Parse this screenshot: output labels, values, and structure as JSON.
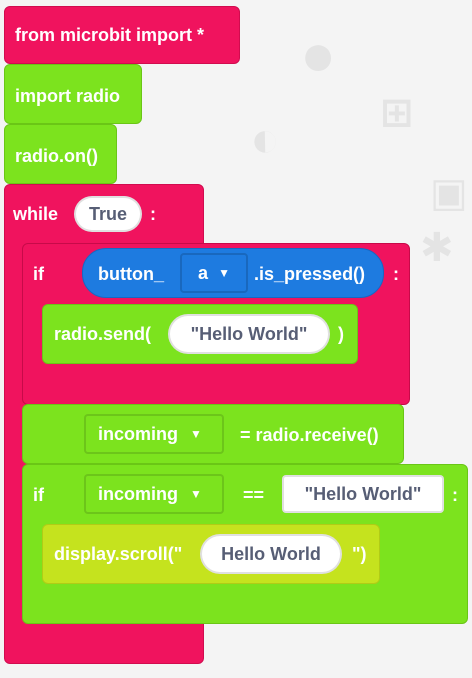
{
  "blocks": {
    "import_microbit": "from microbit import *",
    "import_radio": "import radio",
    "radio_on": "radio.on()",
    "while_kw": "while",
    "while_value": "True",
    "while_colon": ":",
    "if1_kw": "if",
    "button_prefix": "button_",
    "button_option": "a",
    "button_suffix": ".is_pressed()",
    "if1_colon": ":",
    "radio_send_prefix": "radio.send(",
    "radio_send_arg": "\"Hello World\"",
    "radio_send_suffix": ")",
    "assign_var": "incoming",
    "assign_expr": "= radio.receive()",
    "if2_kw": "if",
    "if2_var": "incoming",
    "if2_op": "==",
    "if2_value": "\"Hello World\"",
    "if2_colon": ":",
    "scroll_prefix": "display.scroll(\"",
    "scroll_arg": "Hello World",
    "scroll_suffix": "\")"
  },
  "icons": {
    "dropdown": "caret-down-icon"
  },
  "colors": {
    "magenta": "#f0135e",
    "green": "#7ce31e",
    "lime": "#c5e31e",
    "blue": "#1e7be0"
  }
}
